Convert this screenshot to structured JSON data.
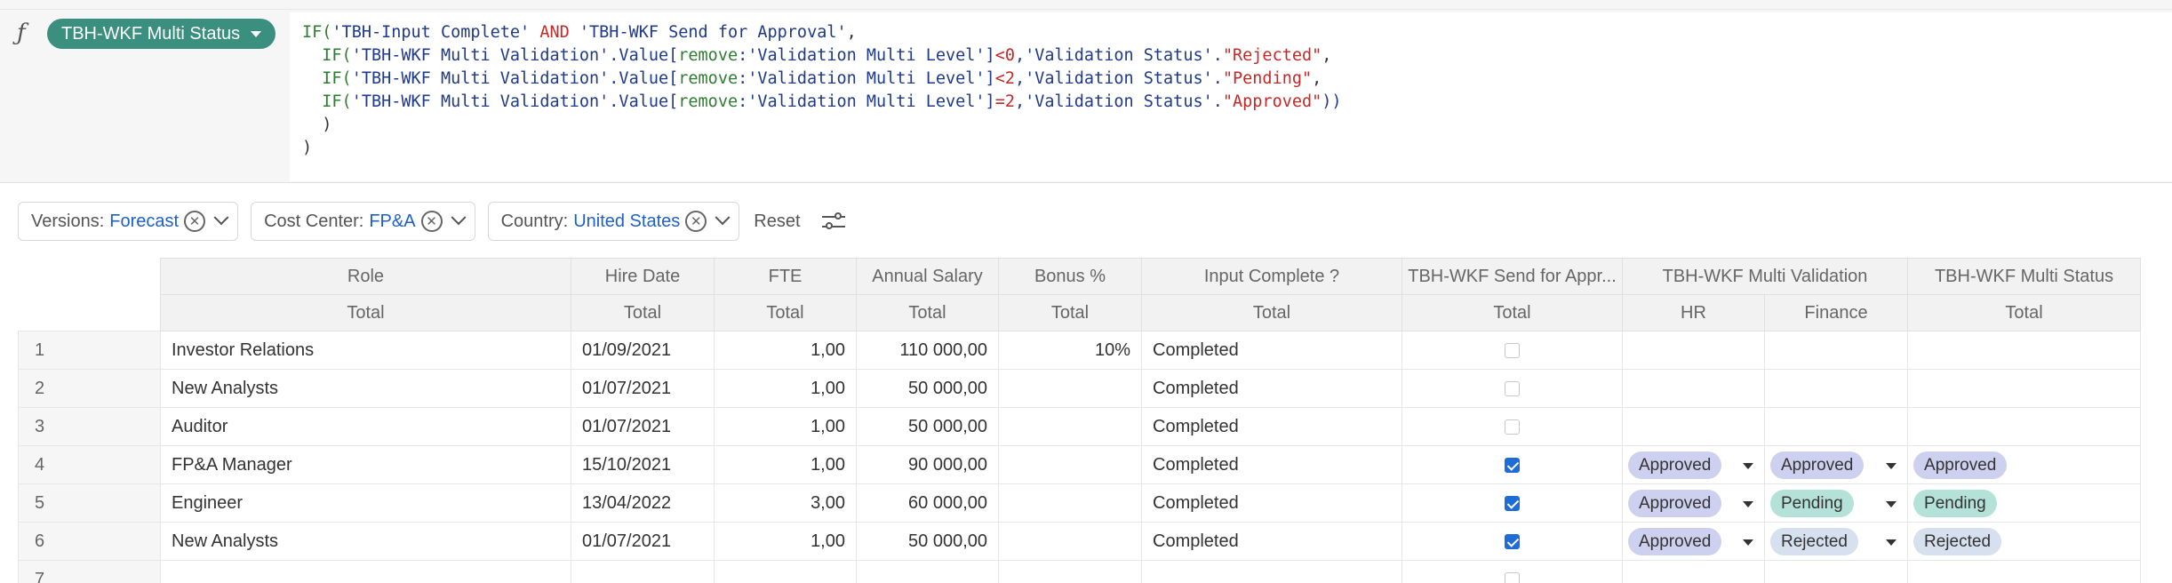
{
  "formula": {
    "metric_name": "TBH-WKF Multi Status",
    "fx_symbol": "ƒ",
    "lines": [
      [
        [
          "fn",
          "IF("
        ],
        [
          "str",
          "'TBH-Input Complete'"
        ],
        [
          "p",
          " "
        ],
        [
          "kw",
          "AND"
        ],
        [
          "p",
          " "
        ],
        [
          "str",
          "'TBH-WKF Send for Approval'"
        ],
        [
          "p",
          ","
        ]
      ],
      [
        [
          "p",
          "  "
        ],
        [
          "fn",
          "IF("
        ],
        [
          "str",
          "'TBH-WKF Multi Validation'"
        ],
        [
          "str",
          ".Value["
        ],
        [
          "fld",
          "remove"
        ],
        [
          "str",
          ":'Validation Multi Level'"
        ],
        [
          "str",
          "]"
        ],
        [
          "op",
          "<0"
        ],
        [
          "str",
          ",'Validation Status'."
        ],
        [
          "lit",
          "\"Rejected\""
        ],
        [
          "p",
          ","
        ]
      ],
      [
        [
          "p",
          "  "
        ],
        [
          "fn",
          "IF("
        ],
        [
          "str",
          "'TBH-WKF Multi Validation'"
        ],
        [
          "str",
          ".Value["
        ],
        [
          "fld",
          "remove"
        ],
        [
          "str",
          ":'Validation Multi Level'"
        ],
        [
          "str",
          "]"
        ],
        [
          "op",
          "<2"
        ],
        [
          "str",
          ",'Validation Status'."
        ],
        [
          "lit",
          "\"Pending\""
        ],
        [
          "p",
          ","
        ]
      ],
      [
        [
          "p",
          "  "
        ],
        [
          "fn",
          "IF("
        ],
        [
          "str",
          "'TBH-WKF Multi Validation'"
        ],
        [
          "str",
          ".Value["
        ],
        [
          "fld",
          "remove"
        ],
        [
          "str",
          ":'Validation Multi Level'"
        ],
        [
          "str",
          "]"
        ],
        [
          "op",
          "=2"
        ],
        [
          "str",
          ",'Validation Status'."
        ],
        [
          "lit",
          "\"Approved\""
        ],
        [
          "str",
          "))"
        ]
      ],
      [
        [
          "p",
          "  )"
        ]
      ],
      [
        [
          "p",
          ")"
        ]
      ]
    ]
  },
  "filters": [
    {
      "label": "Versions:",
      "value": "Forecast"
    },
    {
      "label": "Cost Center:",
      "value": "FP&A"
    },
    {
      "label": "Country:",
      "value": "United States"
    }
  ],
  "reset_label": "Reset",
  "table": {
    "headers": [
      "Role",
      "Hire Date",
      "FTE",
      "Annual Salary",
      "Bonus %",
      "Input Complete ?",
      "TBH-WKF Send for Appr...",
      "TBH-WKF Multi Validation",
      "TBH-WKF Multi Status"
    ],
    "subheaders": [
      "Total",
      "Total",
      "Total",
      "Total",
      "Total",
      "Total",
      "Total",
      "HR",
      "Finance",
      "Total"
    ],
    "rows": [
      {
        "n": "1",
        "role": "Investor Relations",
        "hire": "01/09/2021",
        "fte": "1,00",
        "salary": "110 000,00",
        "bonus": "10%",
        "input": "Completed",
        "send": false,
        "hr": "",
        "fin": "",
        "status": ""
      },
      {
        "n": "2",
        "role": "New Analysts",
        "hire": "01/07/2021",
        "fte": "1,00",
        "salary": "50 000,00",
        "bonus": "",
        "input": "Completed",
        "send": false,
        "hr": "",
        "fin": "",
        "status": ""
      },
      {
        "n": "3",
        "role": "Auditor",
        "hire": "01/07/2021",
        "fte": "1,00",
        "salary": "50 000,00",
        "bonus": "",
        "input": "Completed",
        "send": false,
        "hr": "",
        "fin": "",
        "status": ""
      },
      {
        "n": "4",
        "role": "FP&A Manager",
        "hire": "15/10/2021",
        "fte": "1,00",
        "salary": "90 000,00",
        "bonus": "",
        "input": "Completed",
        "send": true,
        "hr": "Approved",
        "fin": "Approved",
        "status": "Approved"
      },
      {
        "n": "5",
        "role": "Engineer",
        "hire": "13/04/2022",
        "fte": "3,00",
        "salary": "60 000,00",
        "bonus": "",
        "input": "Completed",
        "send": true,
        "hr": "Approved",
        "fin": "Pending",
        "status": "Pending"
      },
      {
        "n": "6",
        "role": "New Analysts",
        "hire": "01/07/2021",
        "fte": "1,00",
        "salary": "50 000,00",
        "bonus": "",
        "input": "Completed",
        "send": true,
        "hr": "Approved",
        "fin": "Rejected",
        "status": "Rejected"
      },
      {
        "n": "7",
        "role": "",
        "hire": "",
        "fte": "",
        "salary": "",
        "bonus": "",
        "input": "",
        "send": false,
        "hr": "",
        "fin": "",
        "status": ""
      }
    ]
  }
}
